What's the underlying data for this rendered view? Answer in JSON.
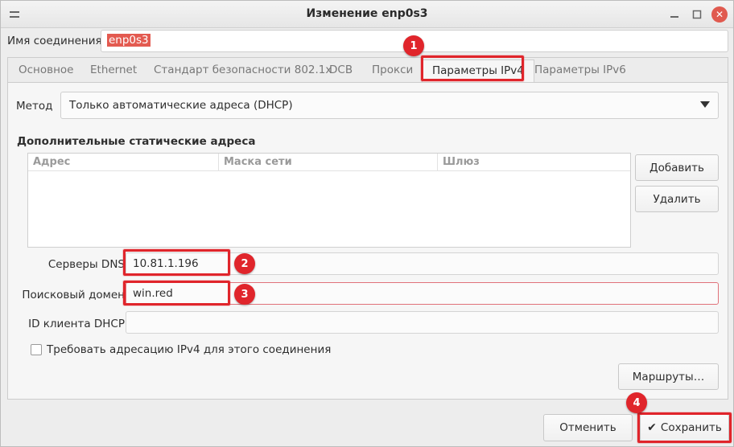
{
  "window": {
    "title": "Изменение enp0s3",
    "connection_name_label": "Имя соединения",
    "connection_name_value": "enp0s3"
  },
  "tabs": [
    {
      "label": "Основное"
    },
    {
      "label": "Ethernet"
    },
    {
      "label": "Стандарт безопасности 802.1x"
    },
    {
      "label": "DCB"
    },
    {
      "label": "Прокси"
    },
    {
      "label": "Параметры IPv4"
    },
    {
      "label": "Параметры IPv6"
    }
  ],
  "active_tab": "Параметры IPv4",
  "ipv4": {
    "method_label": "Метод",
    "method_value": "Только автоматические адреса (DHCP)",
    "static_section_title": "Дополнительные статические адреса",
    "columns": [
      "Адрес",
      "Маска сети",
      "Шлюз"
    ],
    "add_button": "Добавить",
    "delete_button": "Удалить",
    "dns_label": "Серверы DNS",
    "dns_value": "10.81.1.196",
    "search_domain_label": "Поисковый домен",
    "search_domain_value": "win.red",
    "dhcp_client_id_label": "ID клиента DHCP",
    "dhcp_client_id_value": "",
    "require_ipv4_label": "Требовать адресацию IPv4 для этого соединения",
    "require_ipv4_checked": false,
    "routes_button": "Маршруты…"
  },
  "footer": {
    "cancel_button": "Отменить",
    "save_button": "Сохранить"
  },
  "annotations": [
    "1",
    "2",
    "3",
    "4"
  ],
  "colors": {
    "highlight": "#e0252b",
    "selection": "#e35a50"
  }
}
